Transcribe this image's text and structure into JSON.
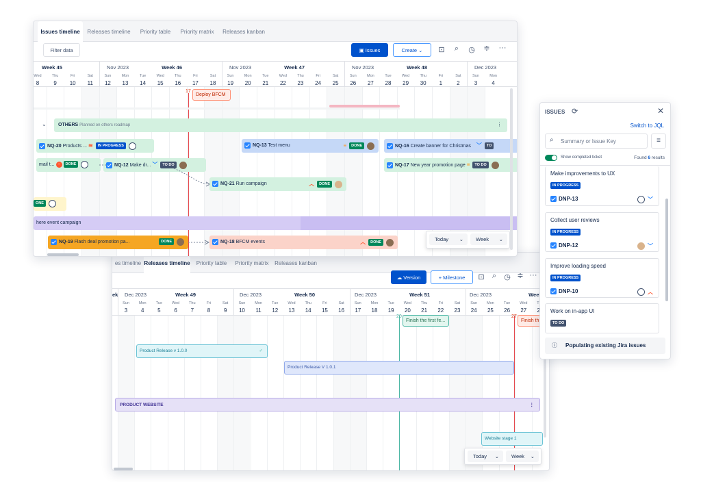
{
  "w1": {
    "tabs": [
      "Issues timeline",
      "Releases timeline",
      "Priority table",
      "Priority matrix",
      "Releases kanban"
    ],
    "filter_label": "Filter data",
    "issues_btn": "Issues",
    "create_btn": "Create",
    "weeks": [
      {
        "month": "",
        "week": "Week 45"
      },
      {
        "month": "Nov 2023",
        "week": "Week 46"
      },
      {
        "month": "Nov 2023",
        "week": "Week 47"
      },
      {
        "month": "Nov 2023",
        "week": "Week 48"
      },
      {
        "month": "Dec 2023",
        "week": ""
      }
    ],
    "day_names": [
      "Wed",
      "Thu",
      "Fri",
      "Sat",
      "Sun",
      "Mon",
      "Tue",
      "Wed",
      "Thu",
      "Fri",
      "Sat",
      "Sun",
      "Mon",
      "Tue",
      "Wed",
      "Thu",
      "Fri",
      "Sat",
      "Sun",
      "Mon",
      "Tue",
      "Wed",
      "Thu",
      "Fri",
      "Sat",
      "Sun",
      "Mon"
    ],
    "day_nums": [
      "8",
      "9",
      "10",
      "11",
      "12",
      "13",
      "14",
      "15",
      "16",
      "17",
      "18",
      "19",
      "20",
      "21",
      "22",
      "23",
      "24",
      "25",
      "26",
      "27",
      "28",
      "29",
      "30",
      "1",
      "2",
      "3",
      "4"
    ],
    "marker": {
      "day": "17",
      "label": "Deploy BFCM"
    },
    "others": {
      "name": "OTHERS",
      "desc": "Planned on others roadmap"
    },
    "bars": {
      "nq20": {
        "key": "NQ-20",
        "title": "Products ...",
        "status": "IN PROGRESS"
      },
      "nq13": {
        "key": "NQ-13",
        "title": "Test menu",
        "status": "DONE"
      },
      "nq16": {
        "key": "NQ-16",
        "title": "Create banner for Christmas",
        "status": "TO"
      },
      "email": {
        "title": "mail t...",
        "status": "DONE"
      },
      "nq12": {
        "key": "NQ-12",
        "title": "Make dr...",
        "status": "TO DO"
      },
      "nq17": {
        "key": "NQ-17",
        "title": "New year promotion page",
        "status": "TO DO"
      },
      "nq21": {
        "key": "NQ-21",
        "title": "Run campaign",
        "status": "DONE"
      },
      "one": {
        "status": "ONE"
      },
      "event": {
        "title": "here event campaign"
      },
      "nq19": {
        "key": "NQ-19",
        "title": "Flash deal promotion pa...",
        "status": "DONE"
      },
      "nq18": {
        "key": "NQ-18",
        "title": "BFCM events",
        "status": "DONE"
      }
    },
    "today_label": "Today",
    "scale_label": "Week"
  },
  "w2": {
    "tabs": [
      "es timeline",
      "Releases timeline",
      "Priority table",
      "Priority matrix",
      "Releases kanban"
    ],
    "version_btn": "Version",
    "milestone_btn": "+ Milestone",
    "weeks": [
      {
        "month": "",
        "week": "ek"
      },
      {
        "month": "Dec 2023",
        "week": "Week 49"
      },
      {
        "month": "Dec 2023",
        "week": "Week 50"
      },
      {
        "month": "Dec 2023",
        "week": "Week 51"
      },
      {
        "month": "Dec 2023",
        "week": "Week"
      }
    ],
    "day_names": [
      "Sun",
      "Mon",
      "Tue",
      "Wed",
      "Thu",
      "Fri",
      "Sat",
      "Sun",
      "Mon",
      "Tue",
      "Wed",
      "Thu",
      "Fri",
      "Sat",
      "Sun",
      "Mon",
      "Tue",
      "Wed",
      "Thu",
      "Fri",
      "Sat",
      "Sun",
      "Mon",
      "Tue",
      "Wed",
      "Thu"
    ],
    "day_nums": [
      "3",
      "4",
      "5",
      "6",
      "7",
      "8",
      "9",
      "10",
      "11",
      "12",
      "13",
      "14",
      "15",
      "16",
      "17",
      "18",
      "19",
      "20",
      "21",
      "22",
      "23",
      "24",
      "25",
      "26",
      "27",
      "28"
    ],
    "milestone1": {
      "day": "20",
      "label": "Finish the first fe..."
    },
    "milestone2": {
      "day": "27",
      "label": "Finish th"
    },
    "release1": "Product Release v 1.0.0",
    "release2": "Product Release V 1.0.1",
    "section": "PRODUCT WEBSITE",
    "stage": "Website stage 1",
    "today_label": "Today",
    "scale_label": "Week"
  },
  "panel": {
    "title": "ISSUES",
    "switch_jql": "Switch to JQL",
    "search_placeholder": "Summary or Issue Key",
    "show_completed": "Show completed ticket",
    "found_prefix": "Found",
    "found_count": "6",
    "found_suffix": "results",
    "cards": [
      {
        "title": "Make improvements to UX",
        "status": "IN PROGRESS",
        "key": "DNP-13"
      },
      {
        "title": "Collect user reviews",
        "status": "IN PROGRESS",
        "key": "DNP-12"
      },
      {
        "title": "Improve loading speed",
        "status": "IN PROGRESS",
        "key": "DNP-10"
      },
      {
        "title": "Work on in-app UI",
        "status": "TO DO",
        "key": ""
      }
    ],
    "footer": "Populating existing Jira issues"
  },
  "colors": {
    "accent": "#0052cc",
    "done": "#00875a",
    "marker": "#e5484d",
    "milestone": "#4cb7a5"
  },
  "icons": [
    "issues-icon",
    "chevron-down-icon",
    "refresh-icon",
    "close-icon",
    "search-icon",
    "filter-icon",
    "info-icon",
    "clock-icon",
    "expand-icon",
    "more-icon",
    "zoom-icon",
    "comment-icon",
    "checkbox-icon",
    "avatar-icon",
    "priority-high-icon",
    "priority-medium-icon",
    "priority-low-icon"
  ]
}
